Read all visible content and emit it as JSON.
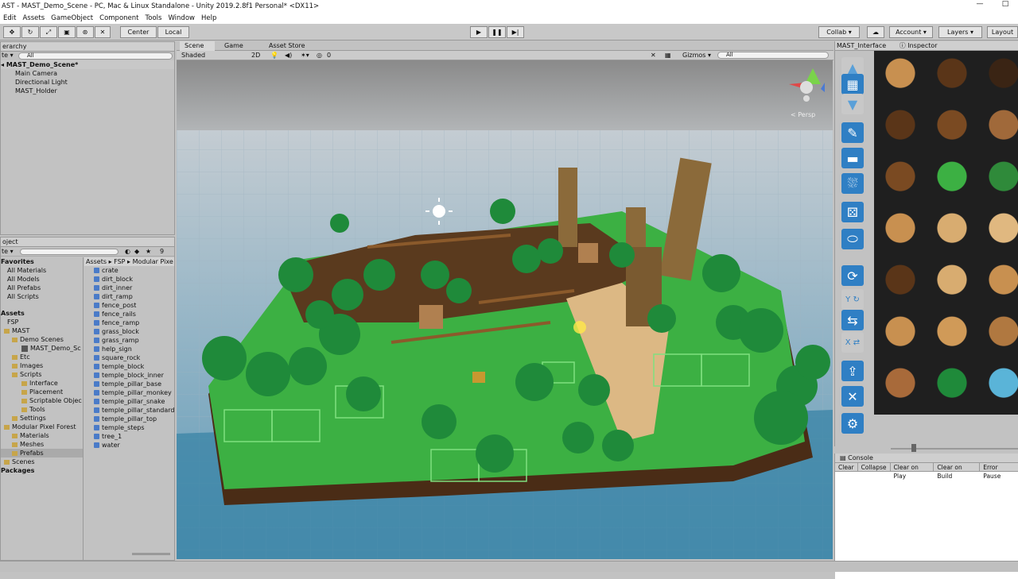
{
  "window": {
    "title": "AST - MAST_Demo_Scene - PC, Mac & Linux Standalone - Unity 2019.2.8f1 Personal* <DX11>",
    "min": "—",
    "max": "□"
  },
  "menu": [
    "Edit",
    "Assets",
    "GameObject",
    "Component",
    "Tools",
    "Window",
    "Help"
  ],
  "toolbar": {
    "center": "Center",
    "local": "Local",
    "collab": "Collab ▾",
    "account": "Account ▾",
    "layers": "Layers ▾",
    "layout": "Layout"
  },
  "hierarchy": {
    "tab": "erarchy",
    "create": "te ▾",
    "search": "All",
    "scene": "MAST_Demo_Scene*",
    "items": [
      "Main Camera",
      "Directional Light",
      "MAST_Holder"
    ]
  },
  "project": {
    "tab": "oject",
    "create": "te ▾",
    "count": "9",
    "favorites_title": "Favorites",
    "favorites": [
      "All Materials",
      "All Models",
      "All Prefabs",
      "All Scripts"
    ],
    "assets_title": "Assets",
    "tree": [
      "FSP",
      "MAST",
      "Demo Scenes",
      "MAST_Demo_Sc",
      "Etc",
      "Images",
      "Scripts",
      "Interface",
      "Placement",
      "Scriptable Objec",
      "Tools",
      "Settings",
      "Modular Pixel Forest",
      "Materials",
      "Meshes",
      "Prefabs"
    ],
    "scenes": "Scenes",
    "packages": "Packages",
    "breadcrumb": "Assets ▸ FSP ▸ Modular Pixe",
    "files": [
      "crate",
      "dirt_block",
      "dirt_inner",
      "dirt_ramp",
      "fence_post",
      "fence_rails",
      "fence_ramp",
      "grass_block",
      "grass_ramp",
      "help_sign",
      "square_rock",
      "temple_block",
      "temple_block_inner",
      "temple_pillar_base",
      "temple_pillar_monkey",
      "temple_pillar_snake",
      "temple_pillar_standard",
      "temple_pillar_top",
      "temple_steps",
      "tree_1",
      "water"
    ]
  },
  "scene_view": {
    "tabs": [
      "Scene",
      "Game",
      "Asset Store"
    ],
    "shading": "Shaded",
    "mode2d": "2D",
    "effects": "0",
    "gizmos": "Gizmos ▾",
    "search": "All",
    "persp": "< Persp"
  },
  "mast": {
    "tab": "MAST_Interface",
    "tab2": "Inspector"
  },
  "console": {
    "tab": "Console",
    "buttons": [
      "Clear",
      "Collapse",
      "Clear on Play",
      "Clear on Build",
      "Error Pause"
    ]
  },
  "icons": {
    "move": "move-icon",
    "play": "play-icon",
    "pause": "pause-icon",
    "step": "step-icon",
    "cloud": "cloud-icon"
  },
  "colors": {
    "accent": "#3a6fb0",
    "grass": "#3cb043",
    "dirt": "#5a3a1e",
    "sand": "#dcb884",
    "water": "#3d86a8",
    "sky": "#b9c2c9",
    "toolbtn": "#2f7fc4"
  }
}
